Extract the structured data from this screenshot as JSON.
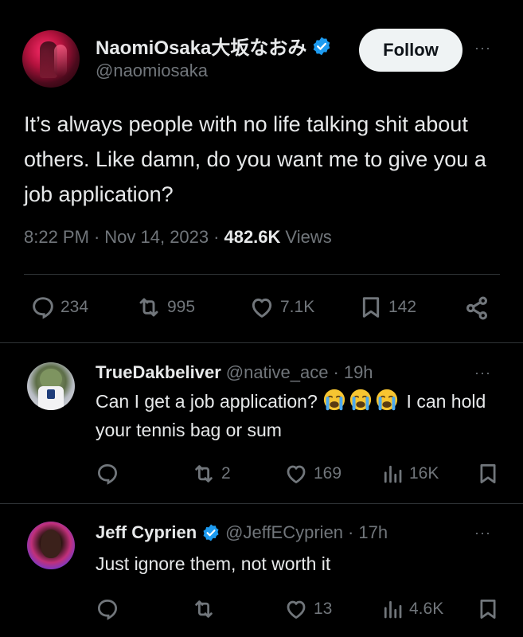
{
  "colors": {
    "background": "#000000",
    "text": "#e7e9ea",
    "muted": "#71767b",
    "verified": "#1d9bf0",
    "divider": "#2f3336"
  },
  "main_tweet": {
    "display_name": "NaomiOsaka大坂なおみ",
    "handle": "@naomiosaka",
    "follow_label": "Follow",
    "more_label": "···",
    "text": "It’s always people with no life talking shit about others. Like damn, do you want me to give you a job application?",
    "time": "8:22 PM",
    "date": "Nov 14, 2023",
    "sep": "·",
    "views_count": "482.6K",
    "views_label": "Views",
    "stats": {
      "replies": "234",
      "reposts": "995",
      "likes": "7.1K",
      "bookmarks": "142"
    },
    "icons": [
      "reply-icon",
      "repost-icon",
      "like-icon",
      "bookmark-icon",
      "share-icon",
      "verified-icon"
    ]
  },
  "replies": [
    {
      "name": "TrueDakbeliver",
      "handle": "@native_ace",
      "sep": "·",
      "age": "19h",
      "text_before": "Can I get a job application? ",
      "emojis": [
        "loudly-crying-face",
        "loudly-crying-face",
        "loudly-crying-face"
      ],
      "text_after": " I can hold your tennis bag or sum",
      "stats": {
        "replies": "",
        "reposts": "2",
        "likes": "169",
        "views": "16K"
      },
      "verified": false
    },
    {
      "name": "Jeff Cyprien",
      "handle": "@JeffECyprien",
      "sep": "·",
      "age": "17h",
      "text": "Just ignore them, not worth it",
      "stats": {
        "replies": "",
        "reposts": "",
        "likes": "13",
        "views": "4.6K"
      },
      "verified": true
    }
  ],
  "more_label": "···"
}
